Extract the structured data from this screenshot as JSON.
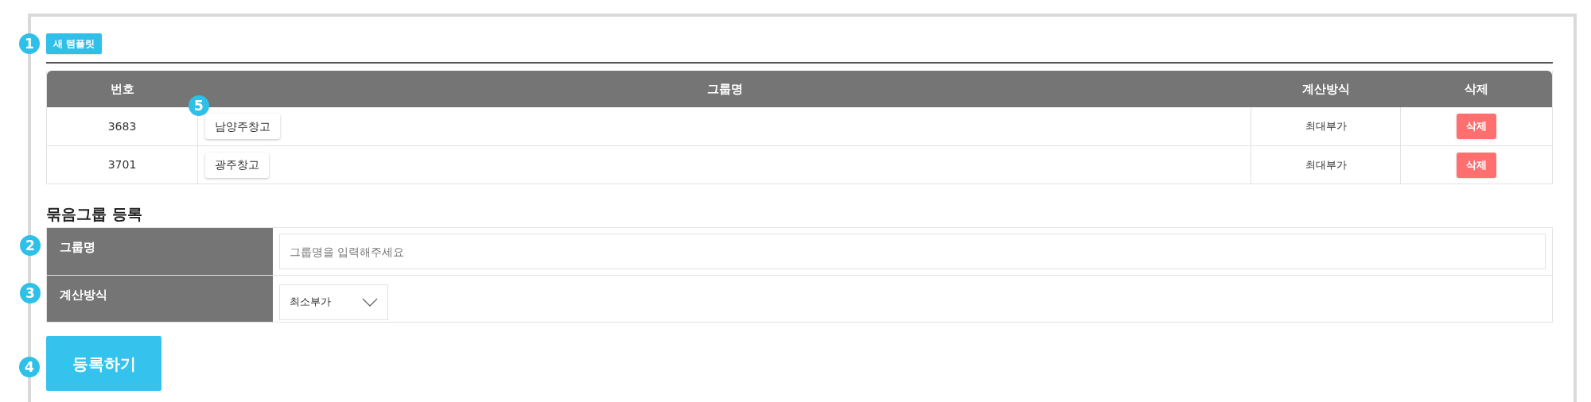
{
  "new_template_button": {
    "label": "새 템플릿",
    "marker": "1"
  },
  "table": {
    "columns": [
      "번호",
      "그룹명",
      "계산방식",
      "삭제"
    ],
    "rows": [
      {
        "number": "3683",
        "group_name": "남양주창고",
        "group_marker": "5",
        "calc_method": "최대부가",
        "delete_button": "삭제"
      },
      {
        "number": "3701",
        "group_name": "광주창고",
        "calc_method": "최대부가",
        "delete_button": "삭제"
      }
    ]
  },
  "form": {
    "title": "묶음그룹 등록",
    "fields": [
      {
        "kind": "text",
        "label": "그룹명",
        "placeholder": "그룹명을 입력해주세요",
        "marker": "2"
      },
      {
        "kind": "select",
        "label": "계산방식",
        "value": "최소부가",
        "marker": "3"
      }
    ]
  },
  "submit_button": {
    "label": "등록하기",
    "marker": "4"
  }
}
